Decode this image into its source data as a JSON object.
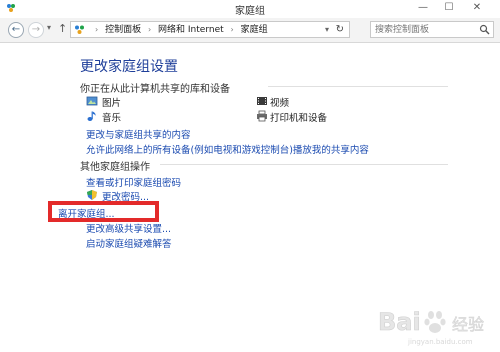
{
  "window": {
    "title": "家庭组",
    "minimize": "—",
    "maximize": "☐",
    "close": "✕"
  },
  "address": {
    "crumbs": [
      "控制面板",
      "网络和 Internet",
      "家庭组"
    ],
    "separator": "›"
  },
  "search": {
    "placeholder": "搜索控制面板"
  },
  "main": {
    "heading": "更改家庭组设置",
    "sharing": {
      "header": "你正在从此计算机共享的库和设备",
      "items": [
        {
          "label": "图片",
          "icon": "pictures-icon"
        },
        {
          "label": "视频",
          "icon": "videos-icon"
        },
        {
          "label": "音乐",
          "icon": "music-icon"
        },
        {
          "label": "打印机和设备",
          "icon": "printer-icon"
        }
      ],
      "links": [
        "更改与家庭组共享的内容",
        "允许此网络上的所有设备(例如电视和游戏控制台)播放我的共享内容"
      ]
    },
    "actions": {
      "header": "其他家庭组操作",
      "links": [
        "查看或打印家庭组密码",
        "更改密码...",
        "离开家庭组...",
        "更改高级共享设置...",
        "启动家庭组疑难解答"
      ]
    }
  },
  "colors": {
    "link": "#1a4ab0",
    "heading": "#1f3f9a",
    "highlight": "#e32a2a"
  },
  "watermark": {
    "brand": "Bai",
    "brand2": "经验",
    "sub": "jingyan.baidu.com"
  }
}
